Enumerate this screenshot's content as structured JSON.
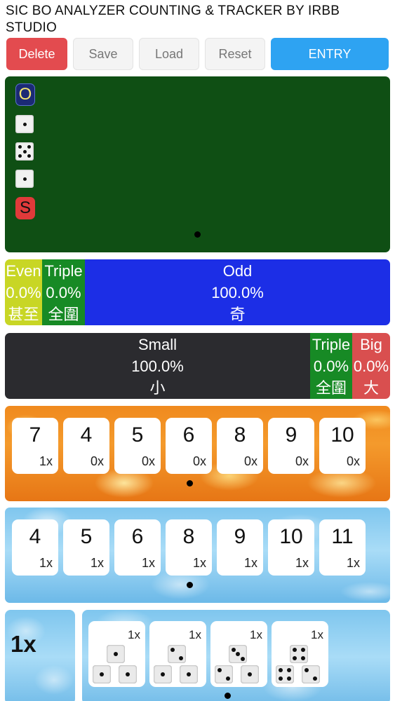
{
  "app_title": "SIC BO ANALYZER COUNTING & TRACKER BY IRBB STUDIO",
  "toolbar": {
    "delete_label": "Delete",
    "save_label": "Save",
    "load_label": "Load",
    "reset_label": "Reset",
    "entry_label": "ENTRY"
  },
  "history": [
    {
      "kind": "marker",
      "text": "O",
      "icon": "odd-marker-icon"
    },
    {
      "kind": "die",
      "value": 1,
      "icon": "die-one-icon"
    },
    {
      "kind": "die",
      "value": 5,
      "icon": "die-five-icon"
    },
    {
      "kind": "die",
      "value": 1,
      "icon": "die-one-icon"
    },
    {
      "kind": "marker",
      "text": "S",
      "icon": "small-marker-icon"
    }
  ],
  "odd_even": {
    "even": {
      "label": "Even",
      "pct": "0.0%",
      "cjk": "甚至",
      "color": "#c8d625"
    },
    "triple": {
      "label": "Triple",
      "pct": "0.0%",
      "cjk": "全圍",
      "color": "#178a25"
    },
    "odd": {
      "label": "Odd",
      "pct": "100.0%",
      "cjk": "奇",
      "color": "#1c2ee6"
    }
  },
  "big_small": {
    "small": {
      "label": "Small",
      "pct": "100.0%",
      "cjk": "小",
      "color": "#2b2b2f"
    },
    "triple": {
      "label": "Triple",
      "pct": "0.0%",
      "cjk": "全圍",
      "color": "#178a25"
    },
    "big": {
      "label": "Big",
      "pct": "0.0%",
      "cjk": "大",
      "color": "#d94f4f"
    }
  },
  "fire_counts": [
    {
      "num": "7",
      "count": "1x"
    },
    {
      "num": "4",
      "count": "0x"
    },
    {
      "num": "5",
      "count": "0x"
    },
    {
      "num": "6",
      "count": "0x"
    },
    {
      "num": "8",
      "count": "0x"
    },
    {
      "num": "9",
      "count": "0x"
    },
    {
      "num": "10",
      "count": "0x"
    }
  ],
  "ice_counts": [
    {
      "num": "4",
      "count": "1x"
    },
    {
      "num": "5",
      "count": "1x"
    },
    {
      "num": "6",
      "count": "1x"
    },
    {
      "num": "8",
      "count": "1x"
    },
    {
      "num": "9",
      "count": "1x"
    },
    {
      "num": "10",
      "count": "1x"
    },
    {
      "num": "11",
      "count": "1x"
    }
  ],
  "combo_total": "1x",
  "combos": [
    {
      "count": "1x",
      "dice": [
        1,
        1,
        1
      ]
    },
    {
      "count": "1x",
      "dice": [
        2,
        1,
        1
      ]
    },
    {
      "count": "1x",
      "dice": [
        3,
        2,
        1
      ]
    },
    {
      "count": "1x",
      "dice": [
        4,
        4,
        2
      ]
    }
  ]
}
